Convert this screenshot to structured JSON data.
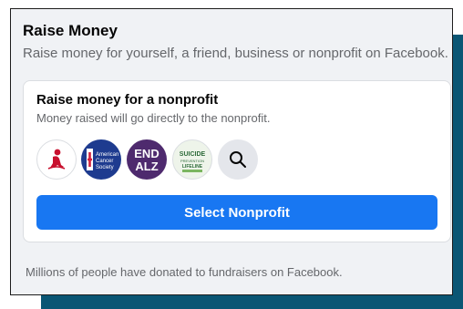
{
  "raise_money": {
    "title": "Raise Money",
    "subtitle": "Raise money for yourself, a friend, business or nonprofit on Facebook."
  },
  "nonprofit_card": {
    "title": "Raise money for a nonprofit",
    "subtitle": "Money raised will go directly to the nonprofit.",
    "logos": [
      {
        "icon": "st-jude-logo-icon"
      },
      {
        "icon": "american-cancer-society-logo-icon",
        "text_lines": [
          "American",
          "Cancer",
          "Society"
        ]
      },
      {
        "icon": "end-alz-logo-icon",
        "text_lines": [
          "END",
          "ALZ"
        ]
      },
      {
        "icon": "suicide-prevention-lifeline-logo-icon",
        "text_lines": [
          "SUICIDE",
          "PREVENTION",
          "LIFELINE"
        ]
      },
      {
        "icon": "search-icon"
      }
    ],
    "button_label": "Select Nonprofit"
  },
  "footer": {
    "text": "Millions of people have donated to fundraisers on Facebook."
  },
  "colors": {
    "accent": "#1877f2",
    "shadow_block": "#0a5674",
    "panel_background": "#f0f2f5",
    "secondary_text": "#65676b"
  }
}
